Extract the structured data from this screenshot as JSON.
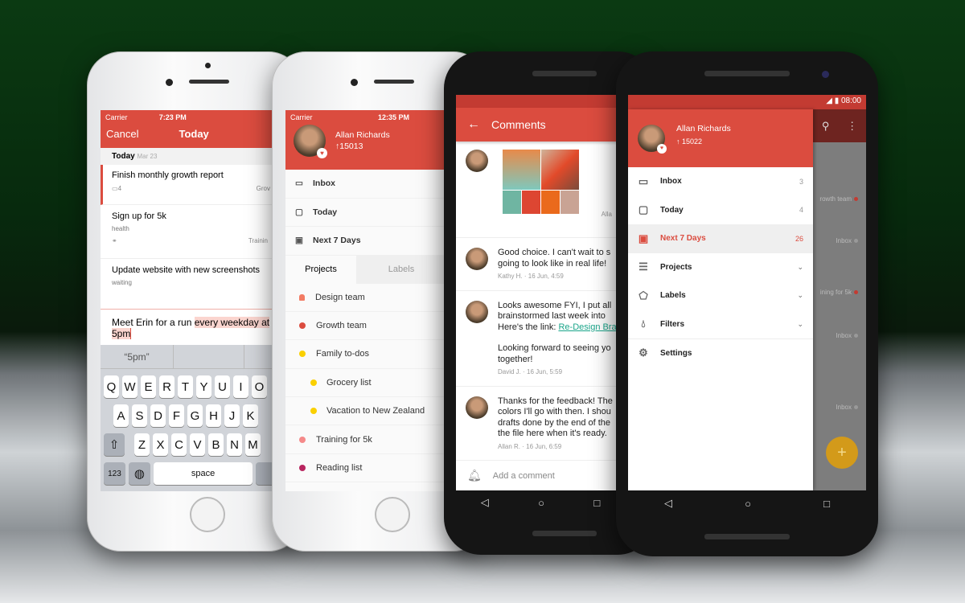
{
  "phone1": {
    "status": {
      "carrier": "Carrier",
      "time": "7:23 PM"
    },
    "header": {
      "cancel": "Cancel",
      "title": "Today"
    },
    "section": {
      "title": "Today",
      "date": "Mar 23"
    },
    "tasks": [
      {
        "title": "Finish monthly growth report",
        "comments": "4",
        "project": "Grov"
      },
      {
        "title": "Sign up for 5k",
        "label": "health",
        "project": "Trainin"
      },
      {
        "title": "Update website with new screenshots",
        "label": "waiting"
      }
    ],
    "input": {
      "plain": "Meet Erin for a run ",
      "highlight": "every weekday at",
      "highlight2": "5pm"
    },
    "suggestion": "“5pm”",
    "keyboard": {
      "row1": [
        "Q",
        "W",
        "E",
        "R",
        "T",
        "Y",
        "U",
        "I",
        "O"
      ],
      "row2": [
        "A",
        "S",
        "D",
        "F",
        "G",
        "H",
        "J",
        "K"
      ],
      "row3": [
        "Z",
        "X",
        "C",
        "V",
        "B",
        "N",
        "M"
      ],
      "num": "123",
      "space": "space"
    }
  },
  "phone2": {
    "status": {
      "carrier": "Carrier",
      "time": "12:35 PM"
    },
    "user": {
      "name": "Allan Richards",
      "karma": "↑15013"
    },
    "nav": [
      {
        "label": "Inbox",
        "icon": "inbox-icon"
      },
      {
        "label": "Today",
        "icon": "calendar-icon"
      },
      {
        "label": "Next 7 Days",
        "icon": "calendar-7-icon"
      }
    ],
    "tabs": [
      "Projects",
      "Labels"
    ],
    "projects": [
      {
        "name": "Design team",
        "color": "#f27b63",
        "shared": true
      },
      {
        "name": "Growth team",
        "color": "#db4c3f"
      },
      {
        "name": "Family to-dos",
        "color": "#fad000"
      },
      {
        "name": "Grocery list",
        "color": "#fad000",
        "sub": true
      },
      {
        "name": "Vacation to New Zealand",
        "color": "#fad000",
        "sub": true
      },
      {
        "name": "Training for 5k",
        "color": "#f58a8a"
      },
      {
        "name": "Reading list",
        "color": "#b8255f"
      }
    ]
  },
  "phone3": {
    "title": "Comments",
    "attachment_author": "Alla",
    "palette": [
      "#6fb5a2",
      "#dd4632",
      "#ea6a1c",
      "#c9a394"
    ],
    "comments": [
      {
        "lines": [
          "Good choice. I can't wait to s",
          "going to look like in real life!"
        ],
        "meta": "Kathy H. · 16 Jun, 4:59"
      },
      {
        "lines": [
          "Looks awesome FYI, I put all",
          "brainstormed last week into",
          "Here's the link: "
        ],
        "link": "Re-Design Bra",
        "lines2": [
          "Looking forward to seeing yo",
          "together!"
        ],
        "meta": "David J. · 16 Jun, 5:59"
      },
      {
        "lines": [
          "Thanks for the feedback! The",
          "colors I'll go with then. I shou",
          "drafts done by the end of the",
          "the file here when it's ready."
        ],
        "meta": "Allan R. · 16 Jun, 6:59"
      }
    ],
    "add_placeholder": "Add a comment"
  },
  "phone4": {
    "status": {
      "time": "08:00"
    },
    "user": {
      "name": "Allan Richards",
      "karma": "↑ 15022"
    },
    "nav": [
      {
        "label": "Inbox",
        "count": "3",
        "icon": "inbox-icon"
      },
      {
        "label": "Today",
        "count": "4",
        "icon": "calendar-icon"
      },
      {
        "label": "Next 7 Days",
        "count": "26",
        "icon": "calendar-7-icon",
        "active": true
      },
      {
        "label": "Projects",
        "icon": "projects-icon",
        "expand": true
      },
      {
        "label": "Labels",
        "icon": "label-icon",
        "expand": true
      },
      {
        "label": "Filters",
        "icon": "filter-icon",
        "expand": true
      },
      {
        "label": "Settings",
        "icon": "gear-icon"
      }
    ],
    "background_items": [
      "rowth team",
      "Inbox",
      "ining for 5k",
      "Inbox",
      "Inbox"
    ],
    "fab": "+"
  },
  "colors": {
    "accent": "#db4c3f",
    "active_bg": "#efefef",
    "link": "#1aa58a",
    "fab": "#d39a1a"
  }
}
